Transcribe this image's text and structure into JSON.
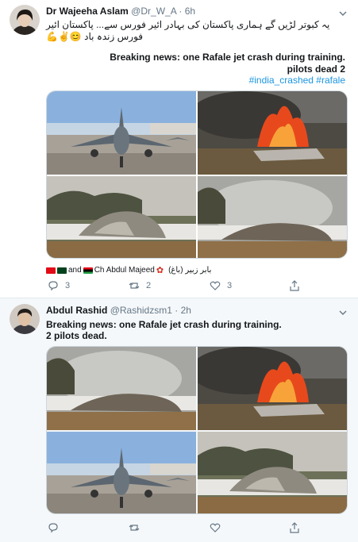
{
  "tweet1": {
    "author_name": "Dr Wajeeha Aslam",
    "handle": "@Dr_W_A",
    "time": "· 6h",
    "urdu_line": "یہ کبوتر لڑیں گے ہماری پاکستان کی بہادر ائیر فورس سے... پاکستان ائیر فورس زندہ باد 😊✌💪",
    "headline": "Breaking news: one Rafale jet crash during training.",
    "subline": "pilots dead 2",
    "hashtags": "#india_crashed #rafale",
    "mention_and": "and",
    "mention_name": "Ch Abdul Majeed",
    "mention_urdu": "بابر زبیر (باغ)",
    "reply_count": "3",
    "retweet_count": "2",
    "like_count": "3"
  },
  "tweet2": {
    "author_name": "Abdul Rashid",
    "handle": "@Rashidzsm1",
    "time": "· 2h",
    "line1": "Breaking news: one Rafale jet crash during training.",
    "line2": "2 pilots dead."
  },
  "colors": {
    "link": "#1b95e0",
    "secondary_text": "#657786",
    "separator": "#e1e8ed"
  },
  "icons": [
    "reply-icon",
    "retweet-icon",
    "like-icon",
    "share-icon",
    "chevron-down-icon"
  ]
}
